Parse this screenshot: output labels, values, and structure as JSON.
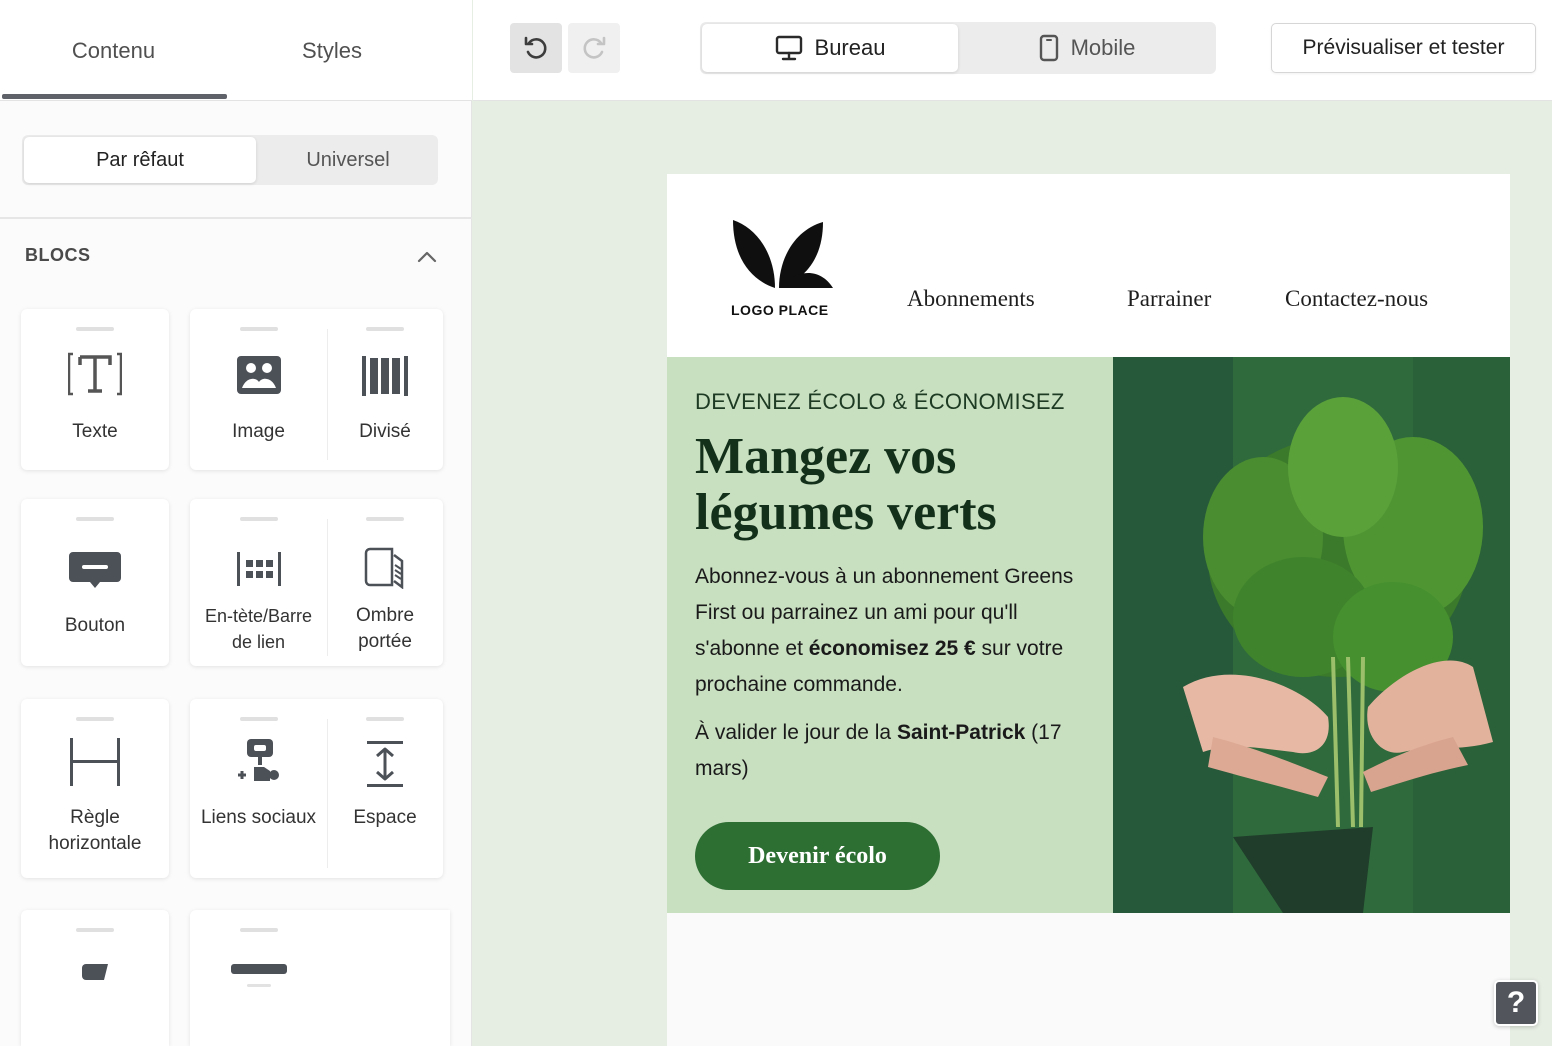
{
  "sidebar": {
    "tabs": [
      {
        "label": "Contenu",
        "active": true
      },
      {
        "label": "Styles",
        "active": false
      }
    ],
    "segment": {
      "active": "Par rêfaut",
      "inactive": "Universel"
    },
    "blocks_header": "BLOCS",
    "blocks": {
      "text": "Texte",
      "image": "Image",
      "split": "Divisé",
      "button": "Bouton",
      "header_line1": "En-tète/Barre",
      "header_line2": "de lien",
      "shadow_line1": "Ombre",
      "shadow_line2": "portée",
      "rule_line1": "Règle",
      "rule_line2": "horizontale",
      "social": "Liens sociaux",
      "space": "Espace"
    }
  },
  "toolbar": {
    "device_active": "Bureau",
    "device_inactive": "Mobile",
    "preview": "Prévisualiser et tester"
  },
  "email": {
    "logo_text": "LOGO PLACE",
    "nav": [
      "Abonnements",
      "Parrainer",
      "Contactez-nous"
    ],
    "eyebrow": "DEVENEZ ÉCOLO & ÉCONOMISEZ",
    "headline_line1": "Mangez vos",
    "headline_line2": "légumes verts",
    "body_part1": "Abonnez-vous à un abonnement Greens First ou parrainez un ami pour qu'll s'abonne et ",
    "body_bold": "économisez 25 €",
    "body_part2": " sur votre prochaine commande.",
    "date_part1": "À valider le jour de la ",
    "date_bold": "Saint-Patrick",
    "date_part2": " (17 mars)",
    "cta": "Devenir écolo"
  },
  "help_label": "?",
  "colors": {
    "canvas_bg": "#e6ede3",
    "hero_bg": "#c8dfc0",
    "cta_bg": "#2d6e33",
    "headline": "#13301a"
  }
}
